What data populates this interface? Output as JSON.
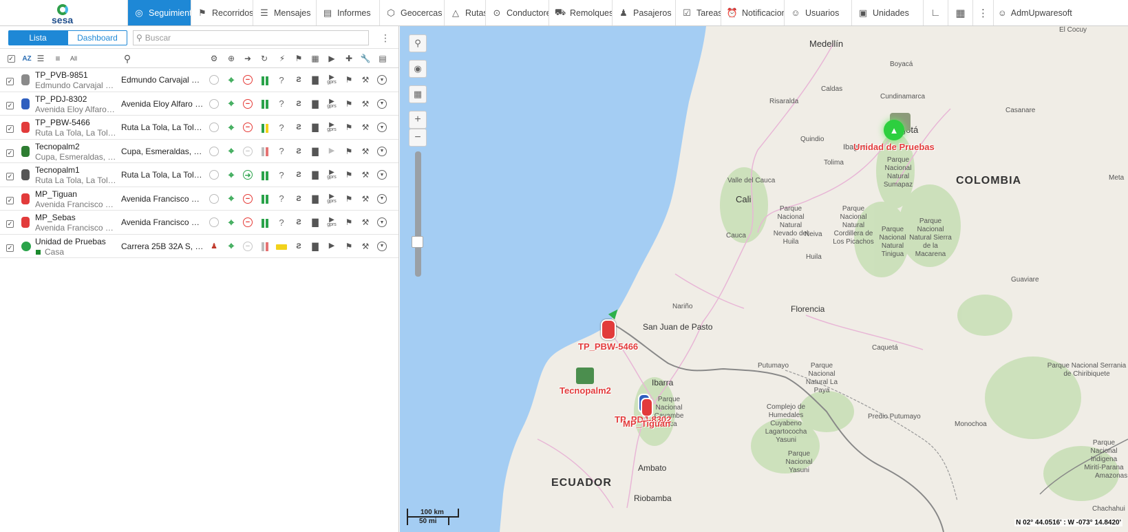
{
  "app": {
    "logo_text": "sesa"
  },
  "nav": [
    {
      "label": "Seguimiento",
      "icon": "globe-icon",
      "active": true
    },
    {
      "label": "Recorridos",
      "icon": "flag-checkered-icon"
    },
    {
      "label": "Mensajes",
      "icon": "messages-icon"
    },
    {
      "label": "Informes",
      "icon": "report-icon"
    },
    {
      "label": "Geocercas",
      "icon": "geofence-icon"
    },
    {
      "label": "Rutas",
      "icon": "route-icon"
    },
    {
      "label": "Conductores",
      "icon": "steering-wheel-icon"
    },
    {
      "label": "Remolques",
      "icon": "trailer-icon"
    },
    {
      "label": "Pasajeros",
      "icon": "passenger-icon"
    },
    {
      "label": "Tareas",
      "icon": "task-icon"
    },
    {
      "label": "Notificaciones",
      "icon": "alarm-icon"
    },
    {
      "label": "Usuarios",
      "icon": "user-icon"
    },
    {
      "label": "Unidades",
      "icon": "bus-icon"
    }
  ],
  "user": {
    "name": "AdmUpwaresoft"
  },
  "panel": {
    "tab_list": "Lista",
    "tab_dashboard": "Dashboard",
    "search_placeholder": "Buscar"
  },
  "units": [
    {
      "name": "TP_PVB-9851",
      "address": "Edmundo Carvajal 64...",
      "location": "Edmundo Carvajal 64...",
      "icon_color": "#8a8a8a",
      "status": "stopped",
      "bar_colors": [
        "#2aa34a",
        "#2aa34a"
      ],
      "motion": "red-stop"
    },
    {
      "name": "TP_PDJ-8302",
      "address": "Avenida Eloy Alfaro 2...",
      "location": "Avenida Eloy Alfaro 2-...",
      "icon_color": "#2f5fbf",
      "status": "stopped",
      "bar_colors": [
        "#2aa34a",
        "#2aa34a"
      ],
      "motion": "red-minus"
    },
    {
      "name": "TP_PBW-5466",
      "address": "Ruta La Tola, La Tola,...",
      "location": "Ruta La Tola, La Tola,...",
      "icon_color": "#e23b3b",
      "status": "stopped",
      "bar_colors": [
        "#2aa34a",
        "#f2d21b"
      ],
      "motion": "red-minus"
    },
    {
      "name": "Tecnopalm2",
      "address": "Cupa, Esmeraldas, E...",
      "location": "Cupa, Esmeraldas, E...",
      "icon_color": "#2e7d32",
      "status": "offline",
      "bar_colors": [
        "#bdbdbd",
        "#e57373"
      ],
      "motion": "grey-minus"
    },
    {
      "name": "Tecnopalm1",
      "address": "Ruta La Tola, La Tola,...",
      "location": "Ruta La Tola, La Tola,...",
      "icon_color": "#555555",
      "status": "moving",
      "bar_colors": [
        "#2aa34a",
        "#2aa34a"
      ],
      "motion": "green-arrow"
    },
    {
      "name": "MP_Tiguan",
      "address": "Avenida Francisco D...",
      "location": "Avenida Francisco De...",
      "icon_color": "#e23b3b",
      "status": "stopped",
      "bar_colors": [
        "#2aa34a",
        "#2aa34a"
      ],
      "motion": "red-minus"
    },
    {
      "name": "MP_Sebas",
      "address": "Avenida Francisco D...",
      "location": "Avenida Francisco De...",
      "icon_color": "#e23b3b",
      "status": "stopped",
      "bar_colors": [
        "#2aa34a",
        "#2aa34a"
      ],
      "motion": "red-minus"
    },
    {
      "name": "Unidad de Pruebas",
      "address": "Casa",
      "location": "Carrera 25B 32A S, R...",
      "icon_color": "#2aa34a",
      "status": "online",
      "bar_colors": [
        "#bdbdbd",
        "#e57373"
      ],
      "motion": "grey-minus"
    }
  ],
  "map": {
    "labels": {
      "medellin": "Medellín",
      "bogota": "Bogotá",
      "colombia": "COLOMBIA",
      "cali": "Cali",
      "ecuador": "ECUADOR",
      "pasto": "San Juan de Pasto",
      "florencia": "Florencia",
      "ibarra": "Ibarra",
      "ambato": "Ambato",
      "riobamba": "Riobamba",
      "el_cocuy": "El Cocuy",
      "boyaca": "Boyacá",
      "caldas": "Caldas",
      "cundinamarca": "Cundinamarca",
      "risaralda": "Risaralda",
      "quindio": "Quindio",
      "ibague": "Ibague",
      "tolima": "Tolima",
      "casanare": "Casanare",
      "meta": "Meta",
      "valle": "Valle del Cauca",
      "cauca": "Cauca",
      "huila": "Huila",
      "neiva": "Neiva",
      "narino": "Nariño",
      "putumayo": "Putumayo",
      "caqueta": "Caquetá",
      "guaviare": "Guaviare",
      "monochoa": "Monochoa",
      "amazonas": "Amazonas",
      "predio": "Predio Putumayo",
      "chachahui": "Chachahui",
      "pn_sumapaz": "Parque Nacional Natural Sumapaz",
      "pn_huila": "Parque Nacional Natural Nevado del Huila",
      "pn_picachos": "Parque Nacional Natural Cordillera de Los Picachos",
      "pn_tinigua": "Parque Nacional Natural Tinigua",
      "pn_macarena": "Parque Nacional Natural Sierra de la Macarena",
      "pn_chiribiquete": "Parque Nacional Serrania de Chiribiquete",
      "pn_la_paya": "Parque Nacional Natural La Paya",
      "pn_cayambe": "Parque Nacional Cayambe Coca",
      "pn_cuyabeno": "Complejo de Humedales Cuyabeno Lagartococha Yasuni",
      "pn_yasuni": "Parque Nacional Yasuni",
      "pn_mirito": "Parque Nacional Indigena Mirití-Parana"
    },
    "vehicle_labels": {
      "prueba": "Unidad de Pruebas",
      "pbw": "TP_PBW-5466",
      "tecno2": "Tecnopalm2",
      "pdj": "TP_PDJ-8302",
      "tiguan": "MP_Tiguan"
    },
    "scale_km": "100 km",
    "scale_mi": "50 mi",
    "coords": "N 02° 44.0516' : W -073° 14.8420'"
  }
}
